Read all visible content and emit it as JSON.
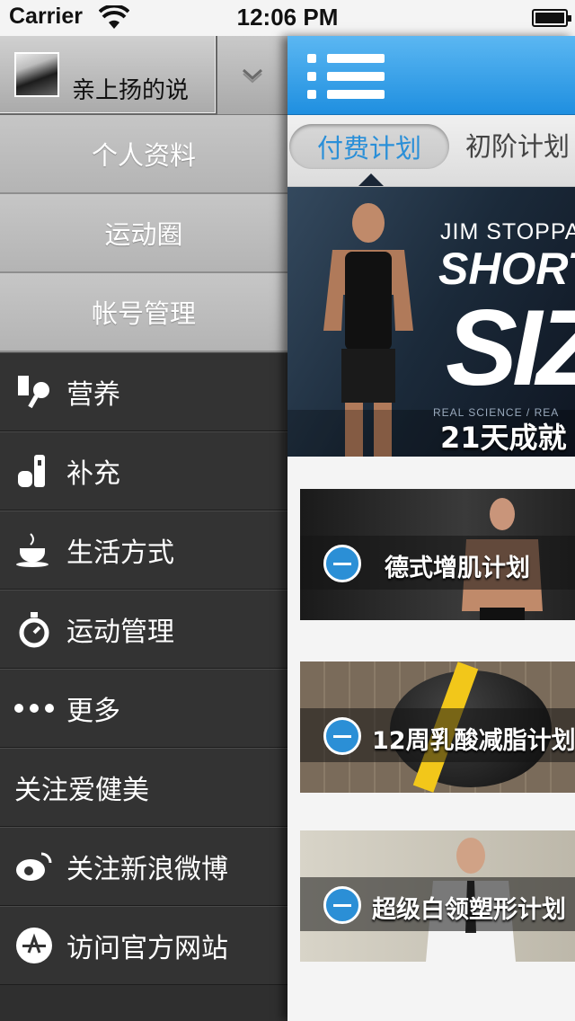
{
  "status_bar": {
    "carrier": "Carrier",
    "time": "12:06 PM"
  },
  "drawer": {
    "user": {
      "name": "亲上扬的说"
    },
    "submenu": [
      "个人资料",
      "运动圈",
      "帐号管理"
    ],
    "menu": [
      {
        "label": "营养",
        "icon": "nutrition-icon"
      },
      {
        "label": "补充",
        "icon": "supplement-icon"
      },
      {
        "label": "生活方式",
        "icon": "coffee-cup-icon"
      },
      {
        "label": "运动管理",
        "icon": "stopwatch-icon"
      },
      {
        "label": "更多",
        "icon": "more-dots-icon"
      },
      {
        "label": "关注爱健美",
        "icon": ""
      },
      {
        "label": "关注新浪微博",
        "icon": "weibo-icon"
      },
      {
        "label": "访问官方网站",
        "icon": "website-logo-icon"
      }
    ]
  },
  "main": {
    "tabs": [
      "付费计划",
      "初阶计划"
    ],
    "hero": {
      "brand": "JIM STOPPA",
      "headline": "SHORT",
      "big": "SIZ",
      "sub": "REAL SCIENCE / REA",
      "caption": "21天成就"
    },
    "cards": [
      {
        "title": "德式增肌计划"
      },
      {
        "title": "12周乳酸减脂计划"
      },
      {
        "title": "超级白领塑形计划"
      }
    ]
  },
  "colors": {
    "accent_blue": "#2a8fd8",
    "navbar_blue": "#1f8fe0",
    "drawer_dark": "#333333",
    "submenu_gray": "#bdbdbd"
  }
}
